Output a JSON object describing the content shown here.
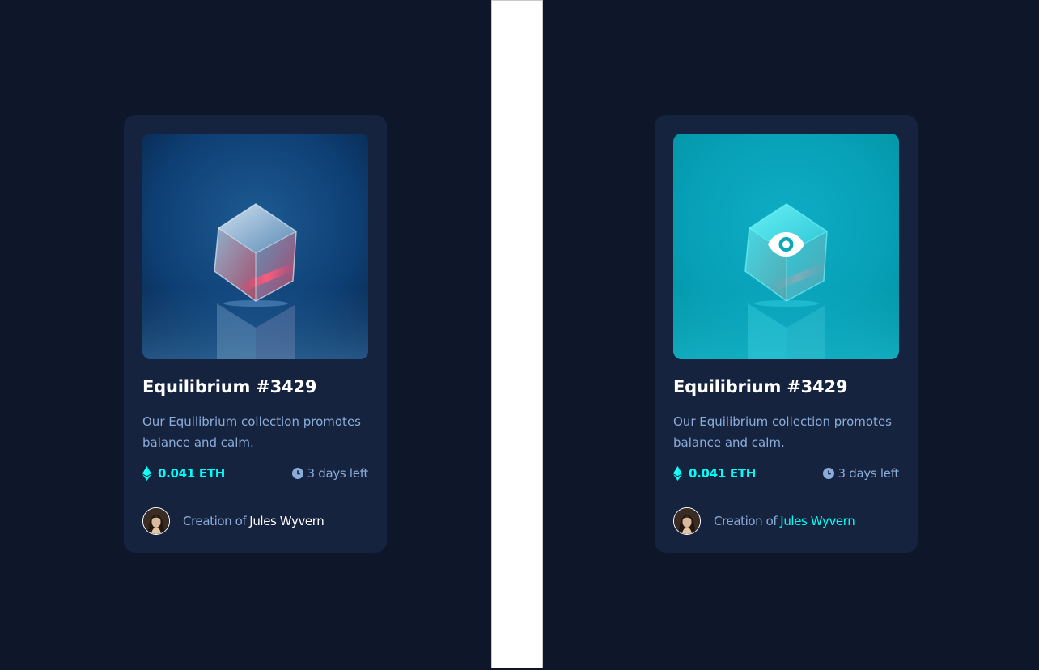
{
  "colors": {
    "page_bg": "#0d1729",
    "card_bg": "#15233f",
    "cyan": "#00fff8",
    "soft_blue": "#8bacd9",
    "white": "#ffffff",
    "divider": "#2e405a"
  },
  "cards": [
    {
      "state": "default",
      "title": "Equilibrium #3429",
      "description": "Our Equilibrium collection promotes balance and calm.",
      "price": "0.041 ETH",
      "time_left": "3 days left",
      "creator_prefix": "Creation of",
      "creator_name": "Jules Wyvern",
      "image_icon": "cube-image",
      "price_icon": "ethereum-icon",
      "time_icon": "clock-icon"
    },
    {
      "state": "hover",
      "title": "Equilibrium #3429",
      "description": "Our Equilibrium collection promotes balance and calm.",
      "price": "0.041 ETH",
      "time_left": "3 days left",
      "creator_prefix": "Creation of",
      "creator_name": "Jules Wyvern",
      "image_icon": "cube-image",
      "overlay_icon": "eye-icon",
      "price_icon": "ethereum-icon",
      "time_icon": "clock-icon"
    }
  ]
}
